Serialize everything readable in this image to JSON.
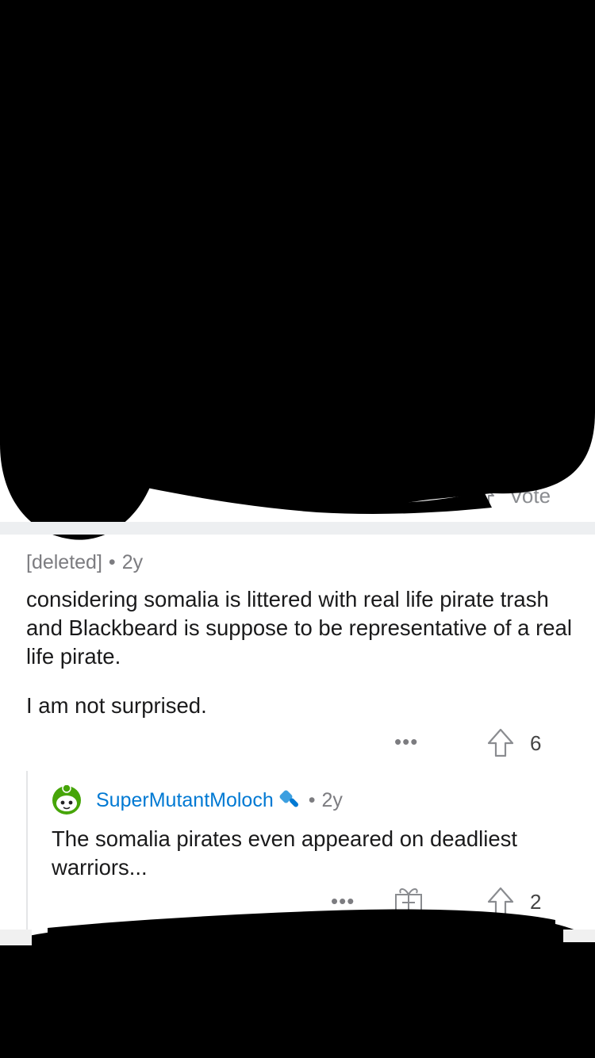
{
  "previous_comment": {
    "vote_label": "Vote"
  },
  "comment": {
    "author": "[deleted]",
    "separator": "•",
    "age": "2y",
    "body": [
      "considering somalia is littered with real life pirate trash and Blackbeard is suppose to be representative of a real life pirate.",
      "I am not surprised."
    ],
    "more": "•••",
    "upvotes": "6"
  },
  "reply": {
    "author": "SuperMutantMoloch",
    "separator": "•",
    "age": "2y",
    "body": "The somalia pirates even appeared on deadliest warriors...",
    "more": "•••",
    "upvotes": "2"
  },
  "colors": {
    "username": "#0079d3",
    "meta_gray": "#7c7c80",
    "divider": "#edeff1",
    "avatar_green": "#46a508",
    "redaction": "#000000"
  },
  "icons": [
    "upvote-icon",
    "award-gift-icon",
    "more-options-icon",
    "mod-flair-icon",
    "avatar-icon"
  ]
}
